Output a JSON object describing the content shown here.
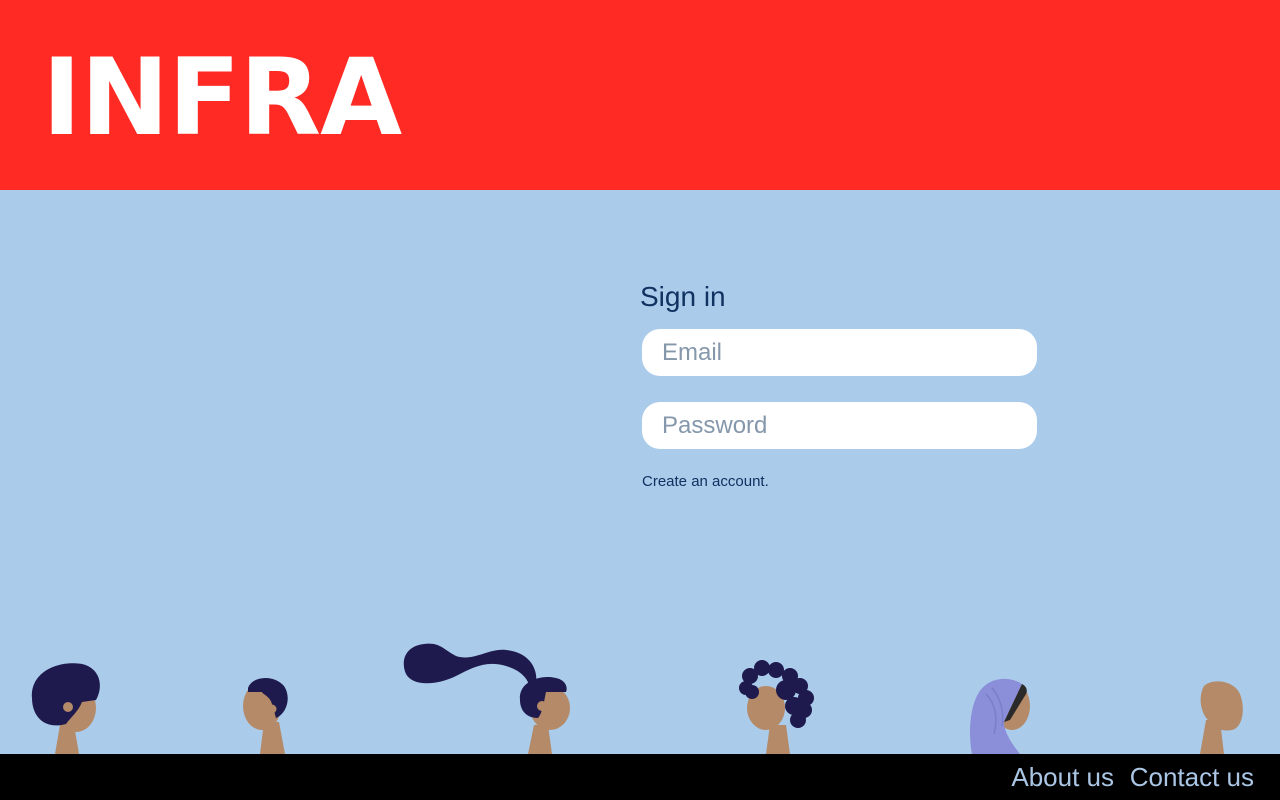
{
  "header": {
    "logo_text": "INFRA",
    "background_color": "#ff2a23"
  },
  "signin": {
    "title": "Sign in",
    "email_placeholder": "Email",
    "email_value": "",
    "password_placeholder": "Password",
    "password_value": "",
    "create_account_link": "Create an account."
  },
  "illustration": {
    "people": [
      "person-short-hair",
      "person-side-part",
      "person-ponytail",
      "person-curly-hair",
      "person-hijab",
      "person-bald"
    ]
  },
  "footer": {
    "about_label": "About us",
    "contact_label": "Contact us"
  },
  "colors": {
    "page_background": "#aacbea",
    "accent_text": "#0f3260",
    "footer_link": "#aac6e4",
    "skin": "#b58a68",
    "hair": "#1e1a4d",
    "hijab": "#8b8fd9"
  }
}
